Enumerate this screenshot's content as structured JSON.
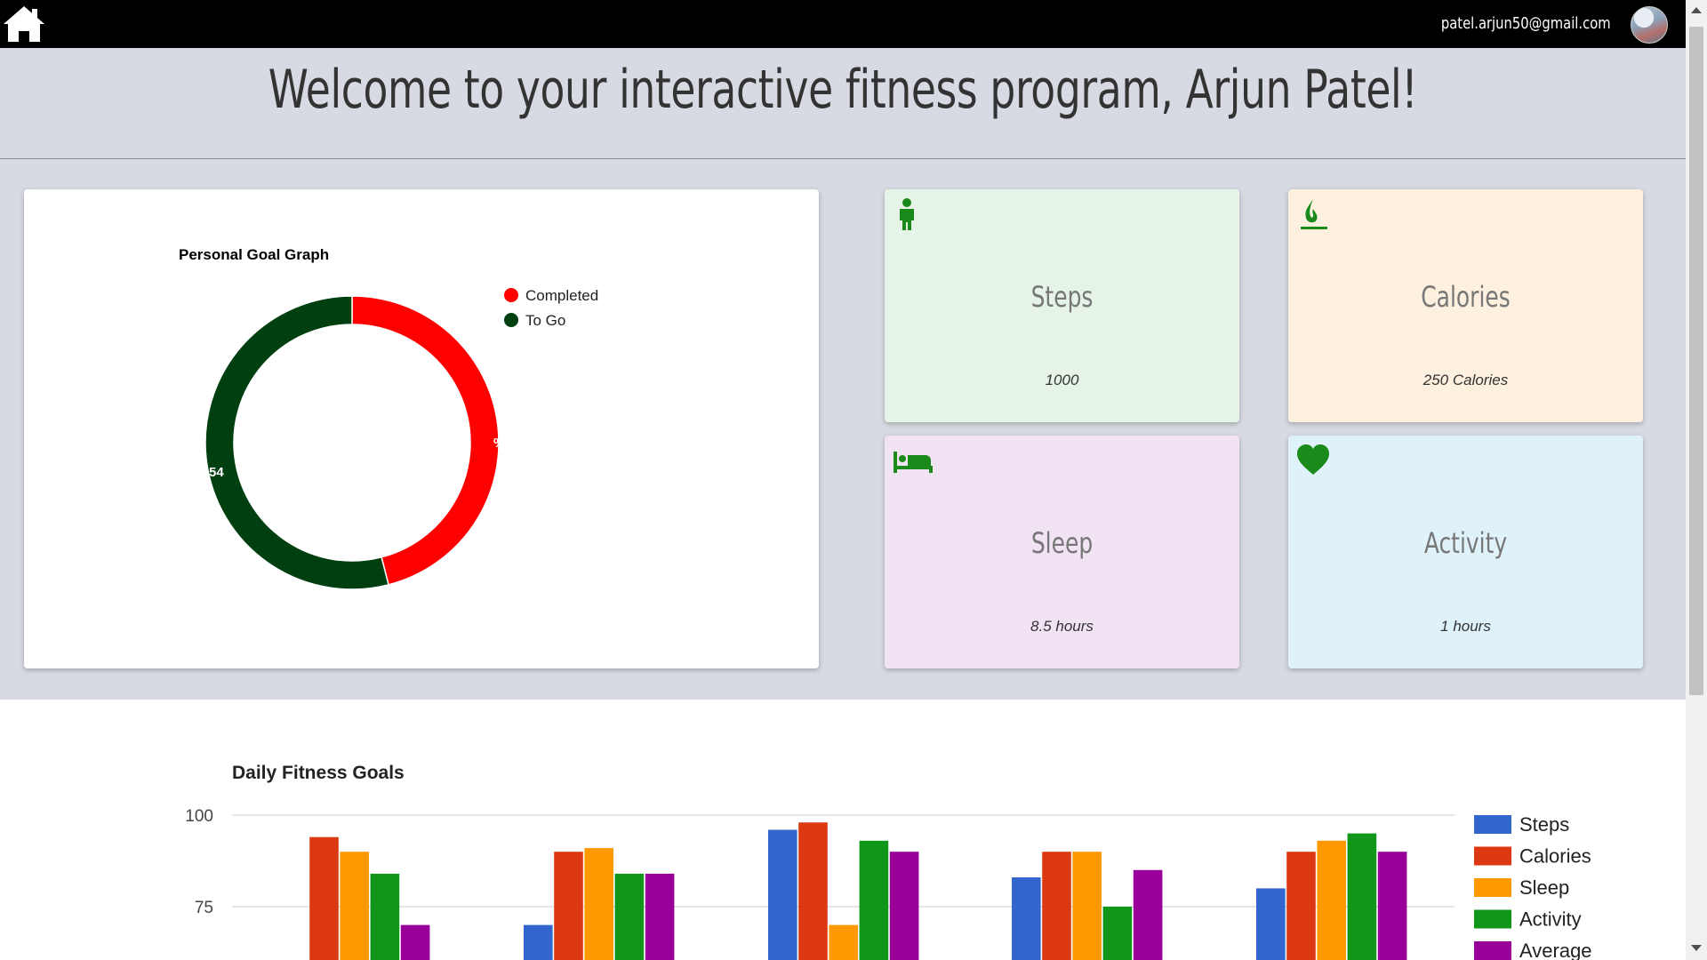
{
  "header": {
    "email": "patel.arjun50@gmail.com"
  },
  "welcome": {
    "title": "Welcome to your interactive fitness program, Arjun Patel!"
  },
  "goal_card": {
    "title": "Personal Goal Graph",
    "legend": [
      {
        "label": "Completed",
        "color": "#ff0000"
      },
      {
        "label": "To Go",
        "color": "#004010"
      }
    ],
    "slice_labels": {
      "completed": "%",
      "to_go": "54"
    }
  },
  "tiles": [
    {
      "label": "Steps",
      "value": "1000",
      "icon": "person-icon",
      "bg": "#e6f4e8"
    },
    {
      "label": "Calories",
      "value": "250 Calories",
      "icon": "flame-icon",
      "bg": "#fdf0de"
    },
    {
      "label": "Sleep",
      "value": "8.5 hours",
      "icon": "bed-icon",
      "bg": "#f1e3f4"
    },
    {
      "label": "Activity",
      "value": "1 hours",
      "icon": "heart-icon",
      "bg": "#dff2fa"
    }
  ],
  "chart_data": [
    {
      "type": "pie",
      "title": "Personal Goal Graph",
      "labels": [
        "Completed",
        "To Go"
      ],
      "values": [
        46,
        54
      ],
      "colors": [
        "#ff0000",
        "#004010"
      ],
      "legend": "right"
    },
    {
      "type": "bar",
      "title": "Daily Fitness Goals",
      "categories": [
        "",
        "",
        "",
        "",
        ""
      ],
      "series": [
        {
          "name": "Steps",
          "color": "#3366cc",
          "values": [
            null,
            70,
            96,
            83,
            80
          ]
        },
        {
          "name": "Calories",
          "color": "#dc3912",
          "values": [
            94,
            90,
            98,
            90,
            90
          ]
        },
        {
          "name": "Sleep",
          "color": "#ff9900",
          "values": [
            90,
            91,
            70,
            90,
            93
          ]
        },
        {
          "name": "Activity",
          "color": "#109618",
          "values": [
            84,
            84,
            93,
            75,
            95
          ]
        },
        {
          "name": "Average",
          "color": "#990099",
          "values": [
            70,
            84,
            90,
            85,
            90
          ]
        }
      ],
      "yticks": [
        100,
        75
      ],
      "ylim": [
        62,
        100
      ],
      "legend": "right"
    }
  ]
}
